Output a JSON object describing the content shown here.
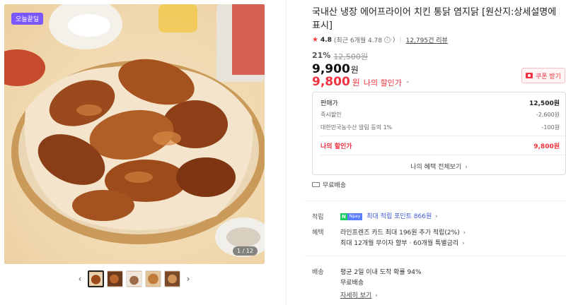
{
  "gallery": {
    "badge": "오늘끝딜",
    "counter": "1 / 12",
    "prev_icon": "chevron-left-icon",
    "next_icon": "chevron-right-icon",
    "thumb_count": 5
  },
  "product": {
    "title": "국내산 냉장 에어프라이어 치킨 통닭 염지닭 [원산지:상세설명에 표시]",
    "rating": "4.8",
    "rating_recent": "(최근 6개월 4.78",
    "rating_recent_close": ")",
    "review_count": "12,795건 리뷰",
    "discount_rate": "21%",
    "original_price": "12,500원",
    "price": "9,900",
    "price_unit": "원",
    "my_price": "9,800",
    "my_price_unit": "원",
    "my_price_label": "나의 할인가",
    "coupon_label": "쿠폰 받기"
  },
  "price_box": {
    "rows": [
      {
        "label": "판매가",
        "value": "12,500원"
      },
      {
        "label": "즉시할인",
        "value": "-2,600원"
      },
      {
        "label": "대한민국농수산 알림 등의 1%",
        "value": "-100원"
      }
    ],
    "mine_label": "나의 할인가",
    "mine_value": "9,800원",
    "see_all": "나의 혜택 전체보기"
  },
  "shipping": {
    "badge": "무료배송"
  },
  "benefits": {
    "point_label": "적립",
    "point_text": "최대 적립 포인트 866원",
    "np_n": "N",
    "np_pay": "Npay",
    "benefit_label": "혜택",
    "benefit_line1": "라인프렌즈 카드 최대 196원 추가 적립(2%)",
    "benefit_line2": "최대 12개월 무이자 할부 · 60개월 특별금리",
    "delivery_label": "배송",
    "delivery_line1": "평균 2일 이내 도착 확률 94%",
    "delivery_line2": "무료배송",
    "details_link": "자세히 보기"
  },
  "colors": {
    "accent_red": "#f0333e",
    "badge_purple": "#7b57ff",
    "npay_green": "#19ce60"
  }
}
